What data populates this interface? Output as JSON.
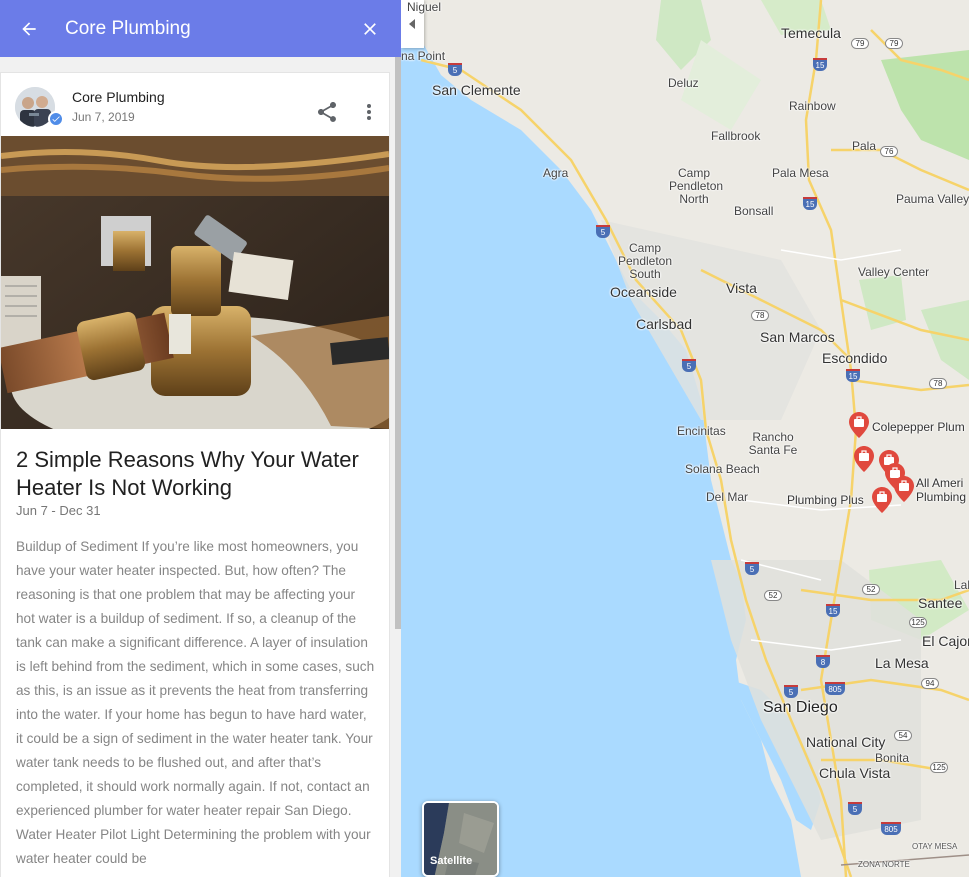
{
  "appbar": {
    "title": "Core Plumbing",
    "back_icon": "arrow-back-icon",
    "close_icon": "close-icon",
    "color": "#6b7ce8"
  },
  "post": {
    "author": "Core Plumbing",
    "date": "Jun 7, 2019",
    "title": "2 Simple Reasons Why Your Water Heater Is Not Working",
    "range": "Jun 7 - Dec 31",
    "body": "Buildup of Sediment If you’re like most homeowners, you have your water heater inspected. But, how often? The reasoning is that one problem that may be affecting your hot water is a buildup of sediment. If so, a cleanup of the tank can make a significant difference. A layer of insulation is left behind from the sediment, which in some cases, such as this, is an issue as it prevents the heat from transferring into the water. If your home has begun to have hard water, it could be a sign of sediment in the water heater tank. Your water tank needs to be flushed out, and after that’s completed, it should work normally again. If not, contact an experienced plumber for water heater repair San Diego. Water Heater Pilot Light Determining the problem with your water heater could be"
  },
  "map": {
    "satellite_label": "Satellite",
    "places": [
      "Niguel",
      "na Point",
      "San Clemente",
      "Temecula",
      "Deluz",
      "Rainbow",
      "Fallbrook",
      "Pala",
      "Agra",
      "Camp Pendleton North",
      "Pala Mesa",
      "Bonsall",
      "Pauma Valley",
      "Camp Pendleton South",
      "Oceanside",
      "Vista",
      "Valley Center",
      "Carlsbad",
      "San Marcos",
      "Escondido",
      "Encinitas",
      "Rancho Santa Fe",
      "Solana Beach",
      "Del Mar",
      "Lak",
      "Santee",
      "El Cajon",
      "La Mesa",
      "San Diego",
      "National City",
      "Bonita",
      "Chula Vista",
      "OTAY MESA",
      "ZONA NORTE"
    ],
    "businesses": [
      "Colepepper Plum",
      "All Ameri Plumbing",
      "Plumbing Plus"
    ],
    "shields": [
      "5",
      "79",
      "79",
      "15",
      "76",
      "15",
      "5",
      "78",
      "15",
      "78",
      "5",
      "5",
      "52",
      "52",
      "15",
      "125",
      "8",
      "805",
      "94",
      "5",
      "54",
      "125",
      "5",
      "805"
    ]
  }
}
